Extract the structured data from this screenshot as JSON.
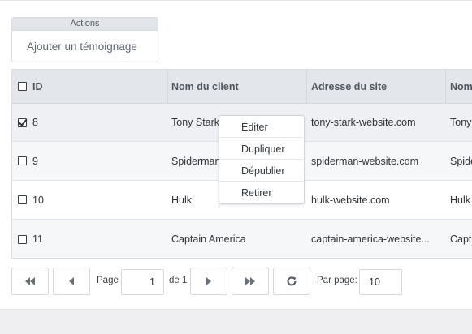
{
  "actions": {
    "header": "Actions",
    "add_testimonial": "Ajouter un témoignage"
  },
  "grid": {
    "columns": {
      "id": "ID",
      "client": "Nom du client",
      "site": "Adresse du site",
      "name_partial": "Nom"
    },
    "rows": [
      {
        "checked": true,
        "id": "8",
        "client": "Tony Stark",
        "site": "tony-stark-website.com",
        "name_partial": "Tony"
      },
      {
        "checked": false,
        "id": "9",
        "client": "Spiderman",
        "site": "spiderman-website.com",
        "name_partial": "Spide"
      },
      {
        "checked": false,
        "id": "10",
        "client": "Hulk",
        "site": "hulk-website.com",
        "name_partial": "Hulk"
      },
      {
        "checked": false,
        "id": "11",
        "client": "Captain America",
        "site": "captain-america-website...",
        "name_partial": "Capt"
      }
    ]
  },
  "context_menu": {
    "items": [
      "Éditer",
      "Dupliquer",
      "Dépublier",
      "Retirer"
    ]
  },
  "pagination": {
    "page_label": "Page",
    "current_page": "1",
    "of_label": "de 1",
    "per_page_label": "Par page:",
    "per_page_value": "10"
  },
  "colors": {
    "header_bg": "#e3e7eb",
    "selected_row_bg": "#eef0f3",
    "alt_row_bg": "#f5f7f9",
    "border": "#d9dde2"
  },
  "icons": {
    "first": "double-chevron-left-icon",
    "prev": "triangle-left-icon",
    "next": "triangle-right-icon",
    "last": "double-chevron-right-icon",
    "refresh": "refresh-icon"
  }
}
